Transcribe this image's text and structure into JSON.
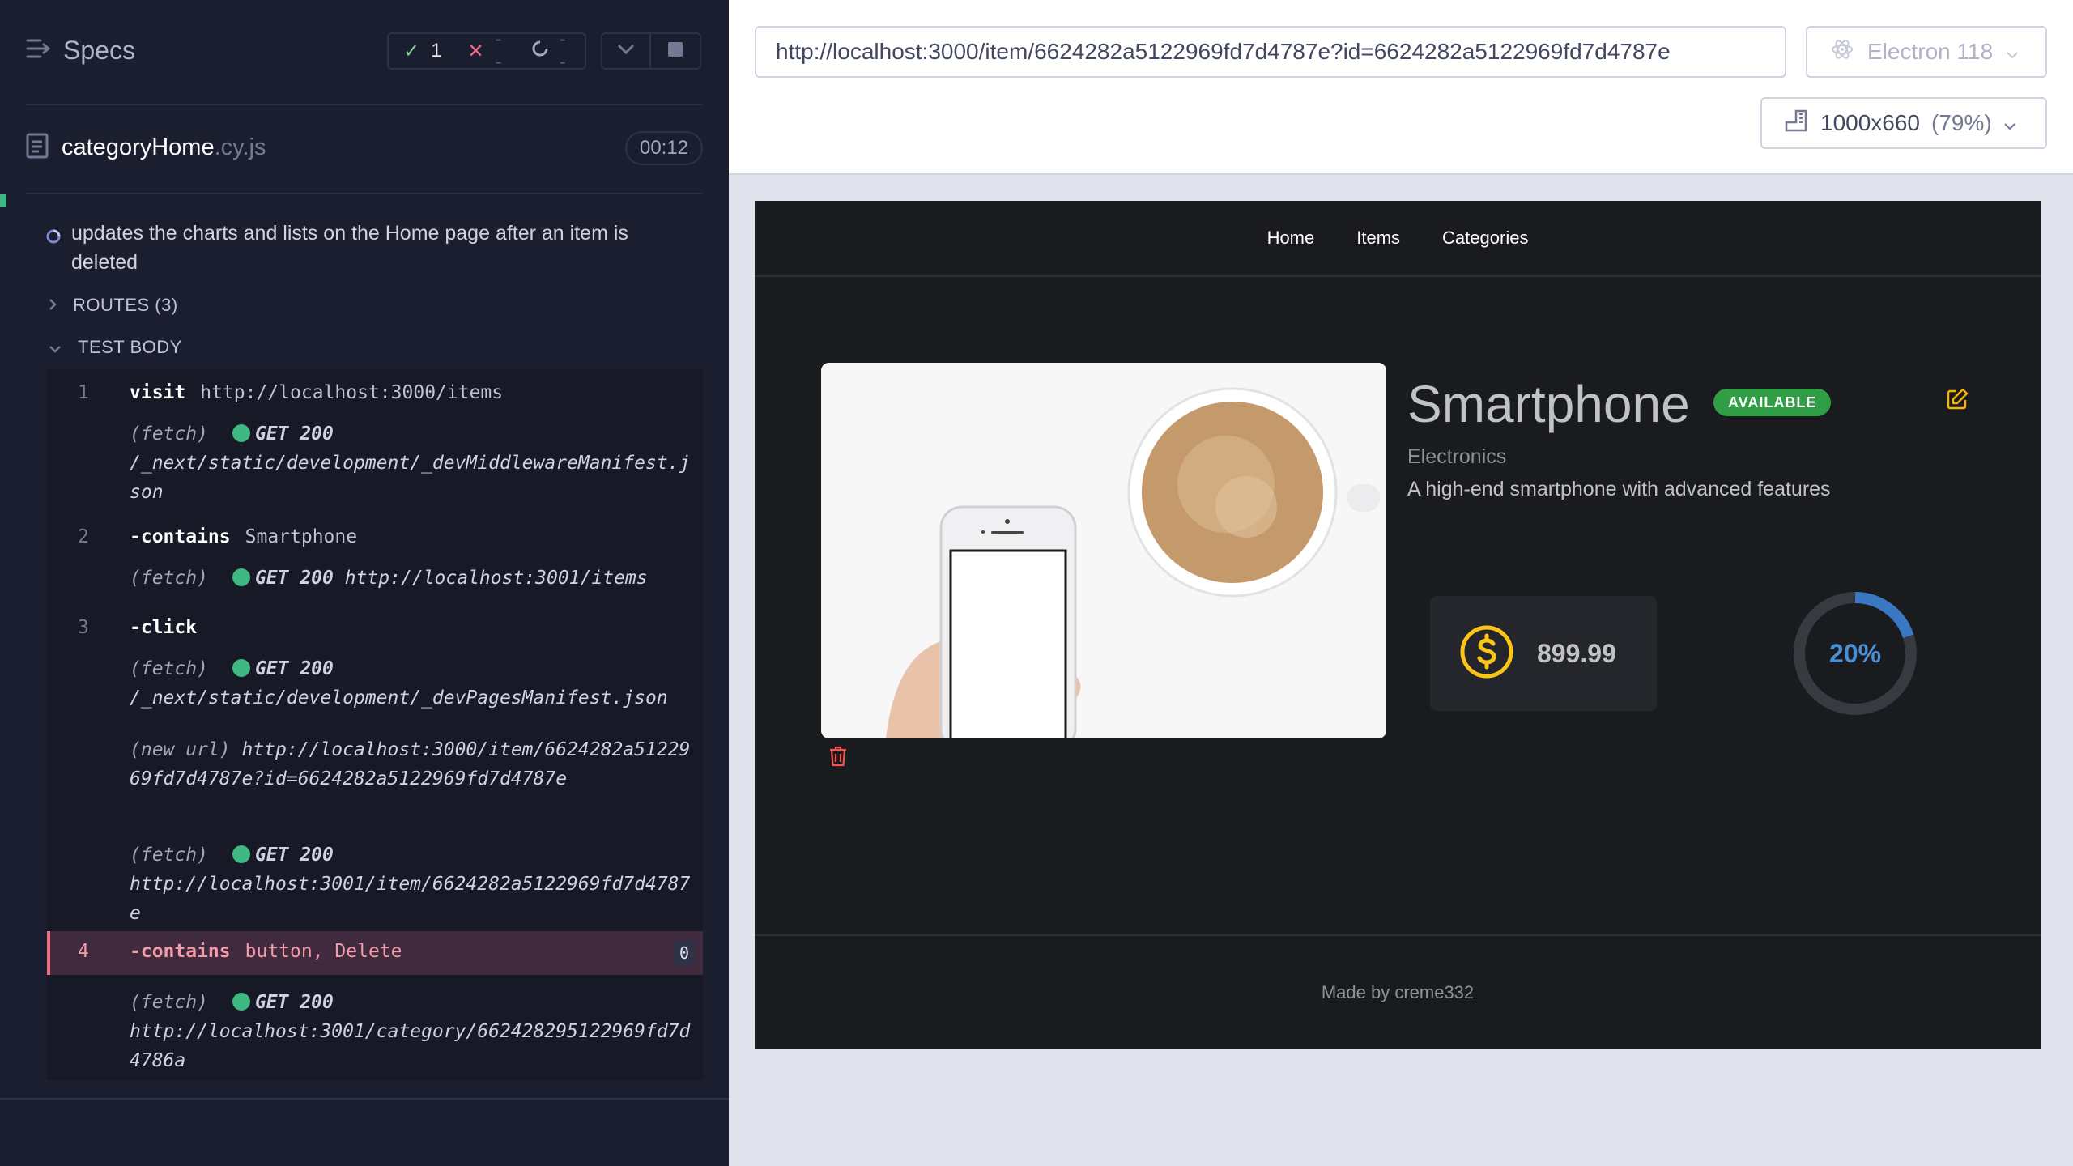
{
  "runner": {
    "header_title": "Specs",
    "stats": {
      "passed": "1",
      "failed": "--",
      "pending": "--"
    },
    "spec": {
      "name": "categoryHome",
      "ext": ".cy.js",
      "timer": "00:12"
    },
    "test_title": "updates the charts and lists on the Home page after an item is deleted",
    "routes_label": "ROUTES (3)",
    "body_label": "TEST BODY",
    "commands": [
      {
        "num": "1",
        "name": "visit",
        "arg": "http://localhost:3000/items"
      },
      {
        "num": "2",
        "name": "-contains",
        "arg": "Smartphone"
      },
      {
        "num": "3",
        "name": "-click",
        "arg": ""
      },
      {
        "num": "4",
        "name": "-contains",
        "arg": "button, Delete",
        "badge": "0"
      }
    ],
    "logs": [
      {
        "label": "(fetch)",
        "method": "GET 200",
        "url": "/_next/static/development/_devMiddlewareManifest.json"
      },
      {
        "label": "(fetch)",
        "method": "GET 200",
        "url": "http://localhost:3001/items"
      },
      {
        "label": "(fetch)",
        "method": "GET 200",
        "url": "/_next/static/development/_devPagesManifest.json"
      },
      {
        "label": "(new url)",
        "url": "http://localhost:3000/item/6624282a5122969fd7d4787e?id=6624282a5122969fd7d4787e"
      },
      {
        "label": "(fetch)",
        "method": "GET 200",
        "url": "http://localhost:3001/item/6624282a5122969fd7d4787e"
      },
      {
        "label": "(fetch)",
        "method": "GET 200",
        "url": "http://localhost:3001/category/662428295122969fd7d4786a"
      }
    ]
  },
  "preview": {
    "url": "http://localhost:3000/item/6624282a5122969fd7d4787e?id=6624282a5122969fd7d4787e",
    "browser": "Electron 118",
    "viewport": "1000x660",
    "scale": "(79%)"
  },
  "app": {
    "nav": [
      "Home",
      "Items",
      "Categories"
    ],
    "product": {
      "name": "Smartphone",
      "status": "AVAILABLE",
      "category": "Electronics",
      "description": "A high-end smartphone with advanced features",
      "price": "899.99",
      "discount_label": "20%",
      "discount_value": 0.2
    },
    "footer": "Made by creme332",
    "colors": {
      "accent": "#4a8fd6",
      "available": "#2f9e44",
      "price_icon": "#fcc419",
      "delete": "#fa5252",
      "edit": "#fab005"
    }
  }
}
